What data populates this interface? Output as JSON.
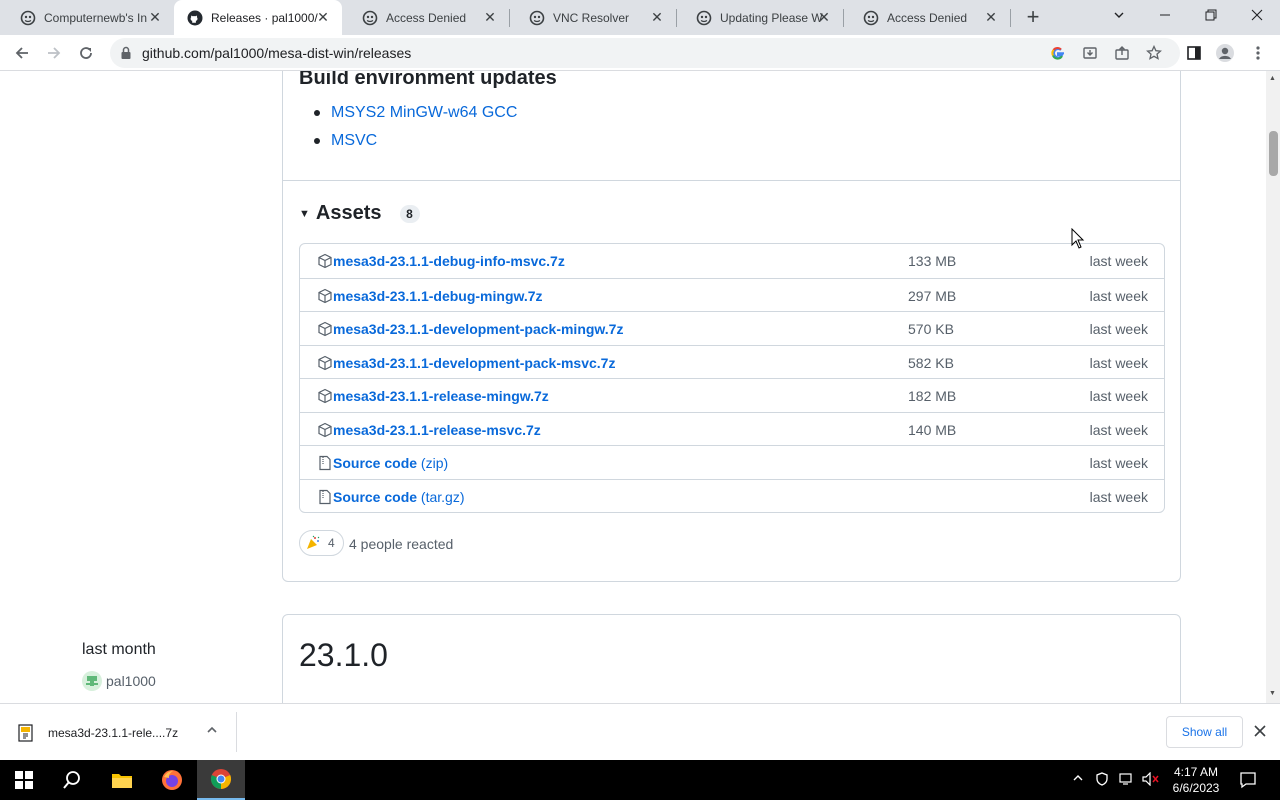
{
  "browser": {
    "tabs": [
      {
        "title": "Computernewb's In",
        "favicon": "computernewb-icon",
        "active": false
      },
      {
        "title": "Releases · pal1000/",
        "favicon": "github-icon",
        "active": true
      },
      {
        "title": "Access Denied",
        "favicon": "computernewb-icon",
        "active": false
      },
      {
        "title": "VNC Resolver",
        "favicon": "computernewb-icon",
        "active": false
      },
      {
        "title": "Updating Please W",
        "favicon": "computernewb-icon",
        "active": false
      },
      {
        "title": "Access Denied",
        "favicon": "computernewb-icon",
        "active": false
      }
    ],
    "new_tab_label": "+",
    "url": "github.com/pal1000/mesa-dist-win/releases"
  },
  "release_current": {
    "section_heading": "Build environment updates",
    "bullets": [
      "MSYS2 MinGW-w64 GCC",
      "MSVC"
    ],
    "assets_title": "Assets",
    "assets_count": "8",
    "assets": [
      {
        "name": "mesa3d-23.1.1-debug-info-msvc.7z",
        "sub": "",
        "size": "133 MB",
        "date": "last week",
        "icon": "package-icon"
      },
      {
        "name": "mesa3d-23.1.1-debug-mingw.7z",
        "sub": "",
        "size": "297 MB",
        "date": "last week",
        "icon": "package-icon"
      },
      {
        "name": "mesa3d-23.1.1-development-pack-mingw.7z",
        "sub": "",
        "size": "570 KB",
        "date": "last week",
        "icon": "package-icon"
      },
      {
        "name": "mesa3d-23.1.1-development-pack-msvc.7z",
        "sub": "",
        "size": "582 KB",
        "date": "last week",
        "icon": "package-icon"
      },
      {
        "name": "mesa3d-23.1.1-release-mingw.7z",
        "sub": "",
        "size": "182 MB",
        "date": "last week",
        "icon": "package-icon"
      },
      {
        "name": "mesa3d-23.1.1-release-msvc.7z",
        "sub": "",
        "size": "140 MB",
        "date": "last week",
        "icon": "package-icon"
      },
      {
        "name": "Source code",
        "sub": " (zip)",
        "size": "",
        "date": "last week",
        "icon": "file-zip-icon"
      },
      {
        "name": "Source code",
        "sub": " (tar.gz)",
        "size": "",
        "date": "last week",
        "icon": "file-zip-icon"
      }
    ],
    "reaction_count": "4",
    "reacted_text": "4 people reacted"
  },
  "release_previous": {
    "time": "last month",
    "author": "pal1000",
    "title": "23.1.0"
  },
  "download_bar": {
    "file_name": "mesa3d-23.1.1-rele....7z",
    "show_all": "Show all"
  },
  "taskbar": {
    "time": "4:17 AM",
    "date": "6/6/2023"
  },
  "colors": {
    "link": "#0969da",
    "border": "#d0d7de",
    "muted": "#57606a"
  }
}
